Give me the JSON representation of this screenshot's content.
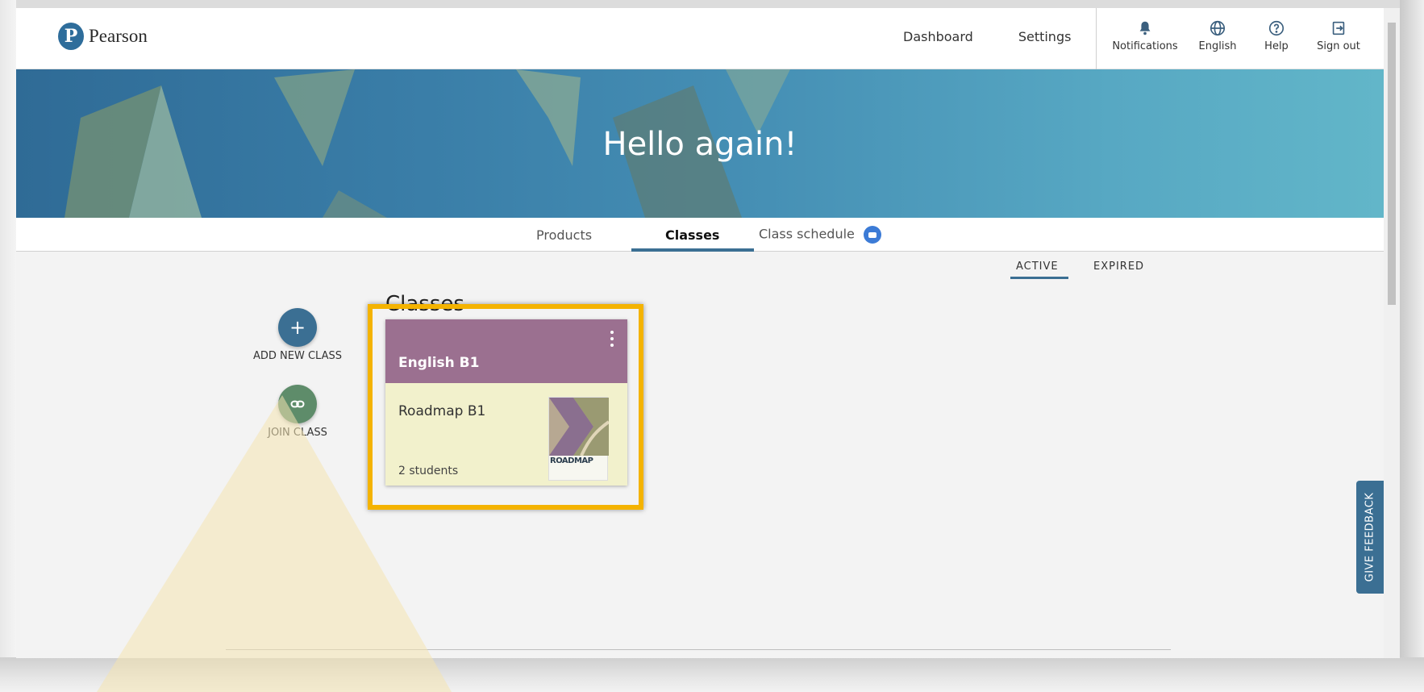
{
  "brand": {
    "logo_letter": "P",
    "name": "Pearson"
  },
  "top_nav": {
    "dashboard": "Dashboard",
    "settings": "Settings"
  },
  "utility": {
    "notifications": "Notifications",
    "language": "English",
    "help": "Help",
    "sign_out": "Sign out"
  },
  "hero": {
    "greeting": "Hello again!"
  },
  "tabs": {
    "products": "Products",
    "classes": "Classes",
    "class_schedule": "Class schedule",
    "active_tab": "Classes"
  },
  "status_filter": {
    "active": "ACTIVE",
    "expired": "EXPIRED",
    "selected": "ACTIVE"
  },
  "section": {
    "title": "Classes"
  },
  "actions": {
    "add_new_class": "ADD NEW CLASS",
    "add_icon": "+",
    "join_class": "JOIN CLASS"
  },
  "class_card": {
    "name": "English B1",
    "product": "Roadmap B1",
    "students": "2 students",
    "cover_title": "ROADMAP"
  },
  "feedback": {
    "label": "GIVE FEEDBACK"
  },
  "colors": {
    "accent": "#3b6f93",
    "card_header": "#9b7090",
    "card_body": "#f2f1cc",
    "highlight": "#f4b300",
    "join_button": "#5e8c6a"
  }
}
